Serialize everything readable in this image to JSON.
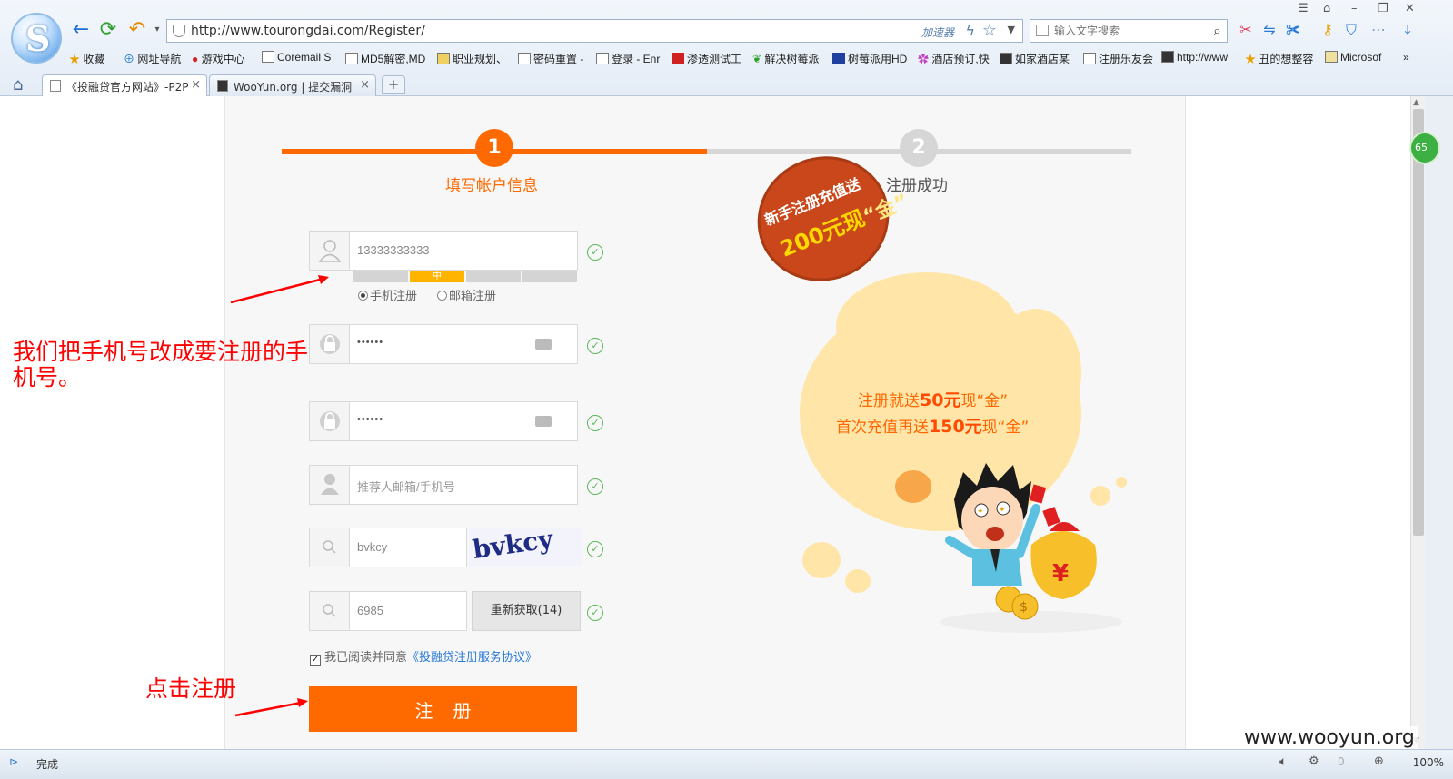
{
  "browser": {
    "url": "http://www.tourongdai.com/Register/",
    "accelerator_label": "加速器",
    "search_placeholder": "输入文字搜索",
    "bookmarks": [
      "收藏",
      "网址导航",
      "游戏中心",
      "Coremail S",
      "MD5解密,MD",
      "职业规划、",
      "密码重置 -",
      "登录 - Enr",
      "渗透测试工",
      "解决树莓派",
      "树莓派用HD",
      "酒店预订,快",
      "如家酒店某",
      "注册乐友会",
      "http://www",
      "丑的想整容",
      "Microsof"
    ],
    "tabs": [
      {
        "label": "《投融贷官方网站》-P2P",
        "active": true
      },
      {
        "label": "WooYun.org | 提交漏洞",
        "active": false
      }
    ],
    "new_tab_label": "+",
    "status_text": "完成",
    "zoom": "100%",
    "side_badge": "65",
    "status_count": "0"
  },
  "steps": [
    {
      "number": "1",
      "label": "填写帐户信息",
      "active": true
    },
    {
      "number": "2",
      "label": "注册成功",
      "active": false
    }
  ],
  "form": {
    "phone_value": "13333333333",
    "register_options": [
      {
        "label": "手机注册",
        "checked": true
      },
      {
        "label": "邮箱注册",
        "checked": false
      }
    ],
    "password_mask": "••••••",
    "strength_label": "中",
    "confirm_mask": "••••••",
    "referrer_placeholder": "推荐人邮箱/手机号",
    "captcha_value": "bvkcy",
    "captcha_text": "bvkcy",
    "sms_code_value": "6985",
    "refetch_label": "重新获取(14)",
    "agree_text": "我已阅读并同意",
    "agree_link": "《投融贷注册服务协议》",
    "submit_label": "注册"
  },
  "promo": {
    "badge_line1": "新手注册充值送",
    "badge_line2": "200元现",
    "badge_gold": "“金”",
    "line1_prefix": "注册就送",
    "line1_amount": "50元",
    "line1_suffix": "现“金”",
    "line2_prefix": "首次充值再送",
    "line2_amount": "150元",
    "line2_suffix": "现“金”"
  },
  "annotations": {
    "note1": "我们把手机号改成要注册的手机号。",
    "note2": "点击注册"
  },
  "watermark": "www.wooyun.org",
  "colors": {
    "accent": "#ff6a00",
    "step_inactive": "#d6d6d6",
    "success_check": "#5bb85b",
    "annotation": "#ff0000",
    "link": "#2a7ad6"
  }
}
